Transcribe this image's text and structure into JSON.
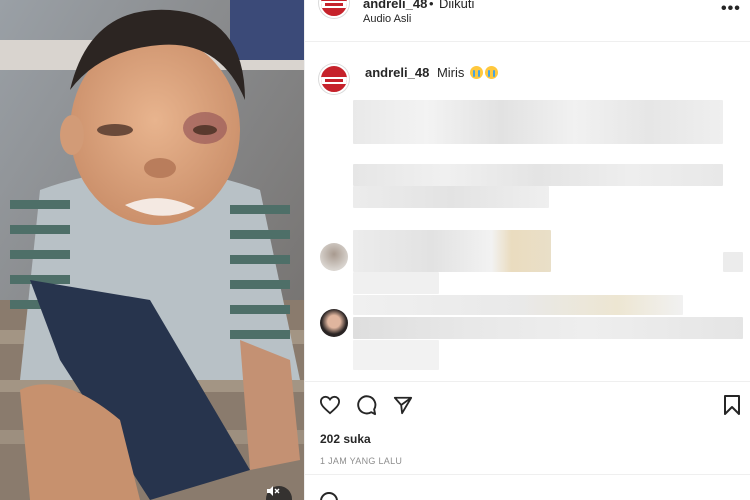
{
  "post": {
    "username": "andreli_48",
    "separator": "•",
    "follow_status": "Diikuti",
    "audio": "Audio Asli",
    "caption_text": "Miris",
    "caption_emojis": [
      "crying-face",
      "crying-face"
    ],
    "likes": "202 suka",
    "time": "1 JAM YANG LALU"
  },
  "colors": {
    "avatar_red": "#c6222b",
    "text": "#262626",
    "muted": "#8e8e8e",
    "divider": "#efefef"
  },
  "icons": {
    "more": "more-options-icon",
    "like": "heart-icon",
    "comment": "comment-icon",
    "share": "paper-plane-icon",
    "save": "bookmark-icon",
    "mute": "muted-speaker-icon",
    "emoji": "smile-icon"
  },
  "comments_note": "pixelated"
}
